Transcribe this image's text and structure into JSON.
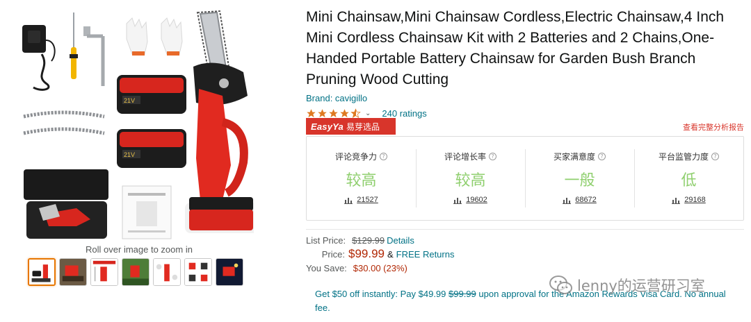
{
  "gallery": {
    "zoom_hint": "Roll over image to zoom in",
    "thumbnails": [
      {
        "name": "thumb-kit",
        "active": true
      },
      {
        "name": "thumb-cutting"
      },
      {
        "name": "thumb-dimensions"
      },
      {
        "name": "thumb-garden"
      },
      {
        "name": "thumb-features"
      },
      {
        "name": "thumb-parts"
      },
      {
        "name": "thumb-night"
      }
    ],
    "product_badge_text": "21V"
  },
  "product": {
    "title": "Mini Chainsaw,Mini Chainsaw Cordless,Electric Chainsaw,4 Inch Mini Cordless Chainsaw Kit with 2 Batteries and 2 Chains,One-Handed Portable Battery Chainsaw for Garden Bush Branch Pruning Wood Cutting",
    "brand": "Brand: cavigillo",
    "rating_stars": 4.5,
    "ratings_count": "240 ratings"
  },
  "easyya": {
    "brand": "EasyYa",
    "brand_cn": "易芽选品",
    "report_link": "查看完整分析报告",
    "accent": "#d8352b",
    "metrics": [
      {
        "label": "评论竞争力",
        "value": "较高",
        "count": "21527"
      },
      {
        "label": "评论增长率",
        "value": "较高",
        "count": "19602"
      },
      {
        "label": "买家满意度",
        "value": "一般",
        "count": "68672"
      },
      {
        "label": "平台监管力度",
        "value": "低",
        "count": "29168"
      }
    ]
  },
  "pricing": {
    "list_price_label": "List Price:",
    "list_price": "$129.99",
    "details": "Details",
    "price_label": "Price:",
    "price": "$99.99",
    "amp": "&",
    "free_returns": "FREE Returns",
    "you_save_label": "You Save:",
    "you_save": "$30.00 (23%)"
  },
  "offer": {
    "part1": "Get $50 off instantly: Pay $49.99 ",
    "strike": "$99.99",
    "part2": " upon approval for the Amazon Rewards Visa Card. No annual fee."
  },
  "watermark": {
    "text": "lenny的运营研习室"
  }
}
